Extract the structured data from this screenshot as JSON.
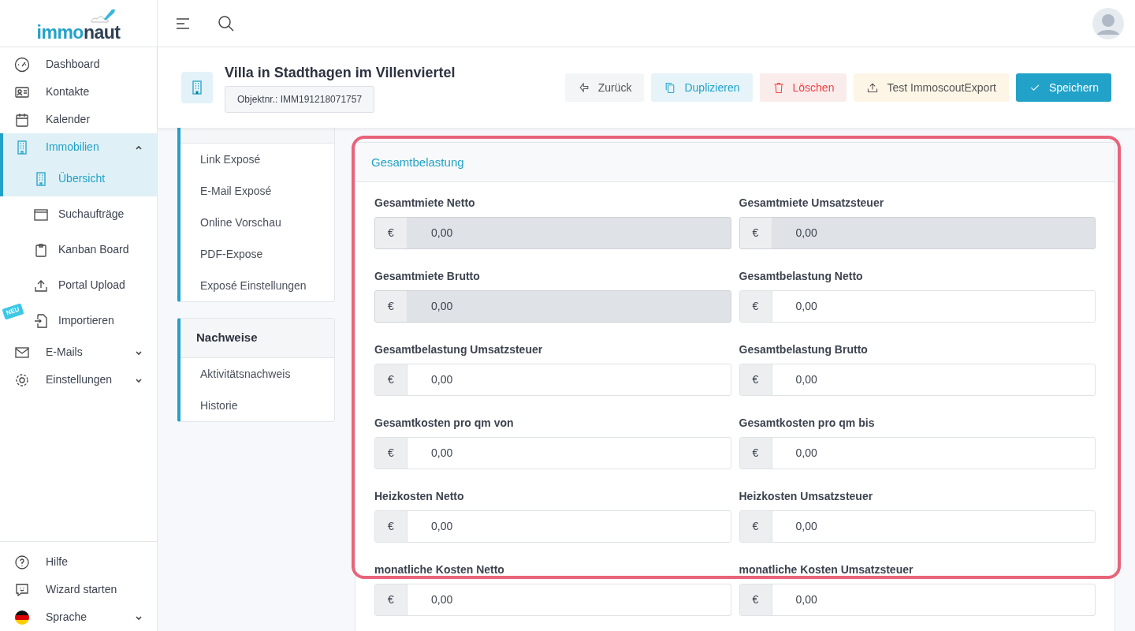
{
  "logo": {
    "part_1": "immo",
    "part_2": "naut"
  },
  "sidebar": {
    "items": [
      {
        "label": "Dashboard",
        "selected": false
      },
      {
        "label": "Kontakte",
        "selected": false
      },
      {
        "label": "Kalender",
        "selected": false
      },
      {
        "label": "Immobilien",
        "selected": true,
        "expanded": true,
        "children": [
          {
            "label": "Übersicht",
            "selected": true
          },
          {
            "label": "Suchaufträge",
            "selected": false
          },
          {
            "label": "Kanban Board",
            "selected": false
          },
          {
            "label": "Portal Upload",
            "selected": false
          },
          {
            "label": "Importieren",
            "selected": false,
            "badge": "NEU"
          }
        ]
      },
      {
        "label": "E-Mails",
        "selected": false,
        "expanded": false
      },
      {
        "label": "Einstellungen",
        "selected": false,
        "expanded": false
      }
    ],
    "bottom_items": [
      {
        "label": "Hilfe",
        "selected": false
      },
      {
        "label": "Wizard starten",
        "selected": false
      },
      {
        "label": "Sprache",
        "selected": false,
        "expanded": false
      }
    ]
  },
  "header": {
    "title": "Villa in Stadthagen im Villenviertel",
    "object_number": "Objektnr.: IMM191218071757",
    "buttons": [
      {
        "label": "Zurück",
        "kind": "light"
      },
      {
        "label": "Duplizieren",
        "kind": "info"
      },
      {
        "label": "Löschen",
        "kind": "danger"
      },
      {
        "label": "Test ImmoscoutExport",
        "kind": "warning"
      },
      {
        "label": "Speichern",
        "kind": "primary"
      }
    ]
  },
  "side_cards": [
    {
      "items": [
        "Link Exposé",
        "E-Mail Exposé",
        "Online Vorschau",
        "PDF-Expose",
        "Exposé Einstellungen"
      ]
    },
    {
      "title": "Nachweise",
      "items": [
        "Aktivitätsnachweis",
        "Historie"
      ]
    }
  ],
  "form": {
    "title": "Gesamtbelastung",
    "highlighted": true,
    "fields": [
      {
        "label": "Gesamtmiete Netto",
        "prefix": "€",
        "value": "0,00",
        "disabled": true
      },
      {
        "label": "Gesamtmiete Umsatzsteuer",
        "prefix": "€",
        "value": "0,00",
        "disabled": true
      },
      {
        "label": "Gesamtmiete Brutto",
        "prefix": "€",
        "value": "0,00",
        "disabled": true
      },
      {
        "label": "Gesamtbelastung Netto",
        "prefix": "€",
        "value": "0,00",
        "disabled": false
      },
      {
        "label": "Gesamtbelastung Umsatzsteuer",
        "prefix": "€",
        "value": "0,00",
        "disabled": false
      },
      {
        "label": "Gesamtbelastung Brutto",
        "prefix": "€",
        "value": "0,00",
        "disabled": false
      },
      {
        "label": "Gesamtkosten pro qm von",
        "prefix": "€",
        "value": "0,00",
        "disabled": false
      },
      {
        "label": "Gesamtkosten pro qm bis",
        "prefix": "€",
        "value": "0,00",
        "disabled": false
      },
      {
        "label": "Heizkosten Netto",
        "prefix": "€",
        "value": "0,00",
        "disabled": false
      },
      {
        "label": "Heizkosten Umsatzsteuer",
        "prefix": "€",
        "value": "0,00",
        "disabled": false
      },
      {
        "label": "monatliche Kosten Netto",
        "prefix": "€",
        "value": "0,00",
        "disabled": false
      },
      {
        "label": "monatliche Kosten Umsatzsteuer",
        "prefix": "€",
        "value": "0,00",
        "disabled": false
      }
    ]
  }
}
